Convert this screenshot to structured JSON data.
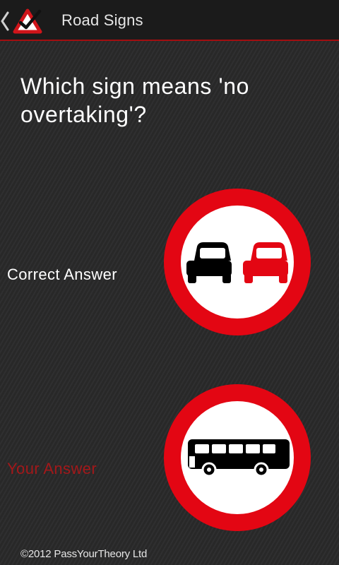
{
  "header": {
    "title": "Road Signs",
    "back_icon": "chevron-left-icon",
    "logo_icon": "warning-triangle-check-icon",
    "accent_color": "#a30e10"
  },
  "question": {
    "text": "Which sign means 'no overtaking'?"
  },
  "answers": {
    "correct": {
      "label": "Correct Answer",
      "sign_icon": "no-overtaking-sign-icon",
      "label_color": "#ffffff"
    },
    "yours": {
      "label": "Your Answer",
      "sign_icon": "no-buses-sign-icon",
      "label_color": "#a3181a"
    }
  },
  "footer": {
    "copyright": "©2012 PassYourTheory Ltd"
  }
}
